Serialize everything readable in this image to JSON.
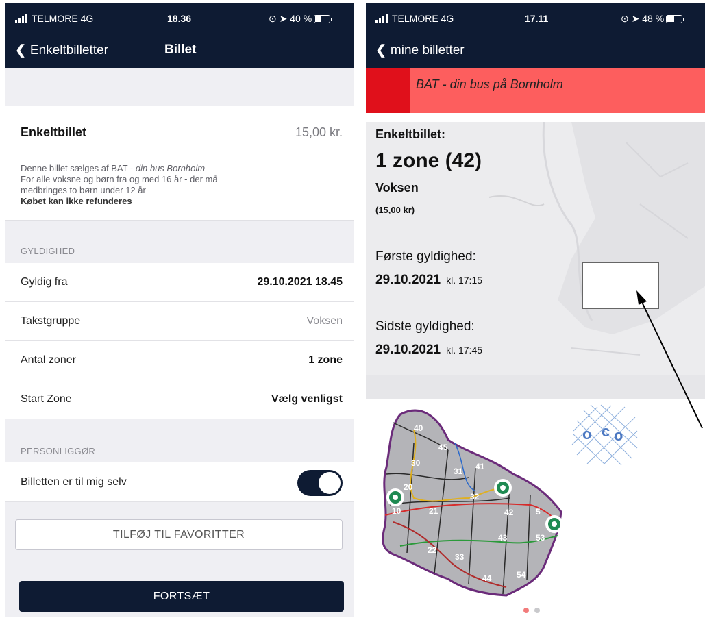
{
  "left_screen": {
    "status": {
      "carrier": "TELMORE 4G",
      "time": "18.36",
      "battery": "40 %",
      "battery_level": 0.4
    },
    "nav": {
      "back_label": "Enkeltbilletter",
      "title": "Billet"
    },
    "ticket": {
      "name": "Enkeltbillet",
      "price": "15,00 kr.",
      "desc_line1_pre": "Denne billet sælges af BAT - ",
      "desc_line1_em": "din bus Bornholm",
      "desc_line2": "For alle voksne og børn fra og med 16 år - der må",
      "desc_line3": "medbringes to børn under 12 år",
      "desc_line4": "Købet kan ikke refunderes"
    },
    "validity": {
      "header": "GYLDIGHED",
      "rows": [
        {
          "label": "Gyldig fra",
          "value": "29.10.2021 18.45"
        },
        {
          "label": "Takstgruppe",
          "value": "Voksen"
        },
        {
          "label": "Antal zoner",
          "value": "1 zone"
        },
        {
          "label": "Start Zone",
          "value": "Vælg venligst"
        }
      ]
    },
    "personalize": {
      "header": "PERSONLIGGØR",
      "toggle_label": "Billetten er til mig selv",
      "toggle_on": true
    },
    "fav_button": "TILFØJ TIL FAVORITTER",
    "continue_button": "FORTSÆT"
  },
  "right_screen": {
    "status": {
      "carrier": "TELMORE 4G",
      "time": "17.11",
      "battery": "48 %",
      "battery_level": 0.48
    },
    "nav": {
      "back_label": "mine billetter"
    },
    "banner": "BAT - din bus på Bornholm",
    "ticket": {
      "title": "Enkeltbillet:",
      "zone": "1 zone (42)",
      "passenger": "Voksen",
      "price": "(15,00 kr)",
      "first_label": "Første gyldighed:",
      "first_date": "29.10.2021",
      "first_time": "kl. 17:15",
      "last_label": "Sidste gyldighed:",
      "last_date": "29.10.2021",
      "last_time": "kl. 17:45"
    },
    "zone_map": {
      "zones": [
        "40",
        "45",
        "30",
        "31",
        "41",
        "20",
        "32",
        "10",
        "21",
        "42",
        "5",
        "43",
        "53",
        "22",
        "33",
        "44",
        "54"
      ]
    },
    "pager": {
      "pages": 2,
      "active": 1
    }
  },
  "colors": {
    "navy": "#0e1b33",
    "banner_red": "#fd5e5e",
    "banner_dark_red": "#e0101b",
    "map_gray": "#b4b4b8",
    "marker_green": "#1f8a52"
  }
}
